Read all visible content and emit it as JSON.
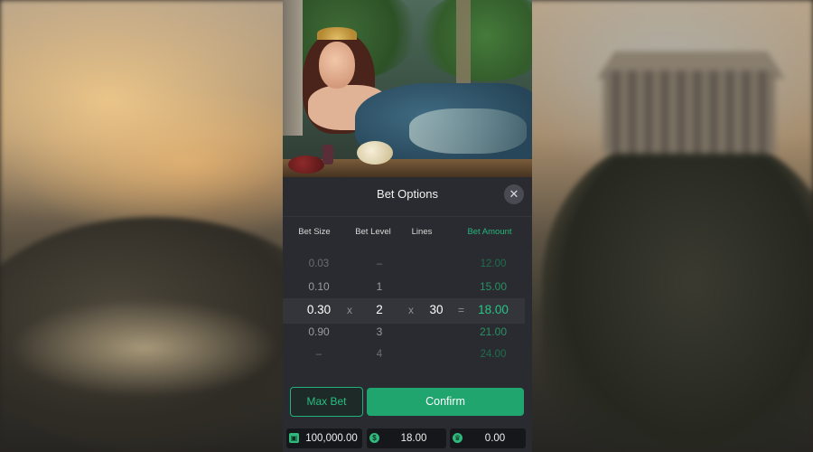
{
  "dialog": {
    "title": "Bet Options",
    "close_symbol": "✕"
  },
  "columns": {
    "bet_size": "Bet Size",
    "bet_level": "Bet Level",
    "lines": "Lines",
    "bet_amount": "Bet Amount"
  },
  "bet_size_wheel": {
    "above2": "0.03",
    "above1": "0.10",
    "selected": "0.30",
    "below1": "0.90",
    "below2": "–"
  },
  "bet_level_wheel": {
    "above2": "–",
    "above1": "1",
    "selected": "2",
    "below1": "3",
    "below2": "4"
  },
  "lines_value": "30",
  "bet_amount_wheel": {
    "above2": "12.00",
    "above1": "15.00",
    "selected": "18.00",
    "below1": "21.00",
    "below2": "24.00"
  },
  "operators": {
    "multiply": "x",
    "equals": "="
  },
  "buttons": {
    "max_bet": "Max Bet",
    "confirm": "Confirm"
  },
  "status_bar": {
    "balance": "100,000.00",
    "bet": "18.00",
    "win": "0.00"
  },
  "colors": {
    "accent": "#25b57a",
    "sheet": "#2a2b30",
    "confirm": "#21a56f"
  }
}
